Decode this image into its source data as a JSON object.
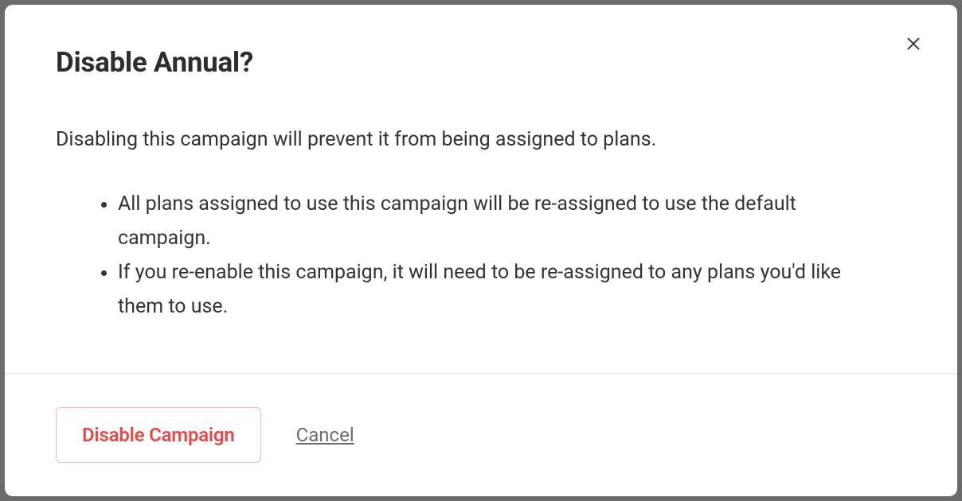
{
  "modal": {
    "title": "Disable Annual?",
    "description": "Disabling this campaign will prevent it from being assigned to plans.",
    "bullets": [
      "All plans assigned to use this campaign will be re-assigned to use the default campaign.",
      "If you re-enable this campaign, it will need to be re-assigned to any plans you'd like them to use."
    ],
    "primary_button": "Disable Campaign",
    "secondary_button": "Cancel"
  }
}
